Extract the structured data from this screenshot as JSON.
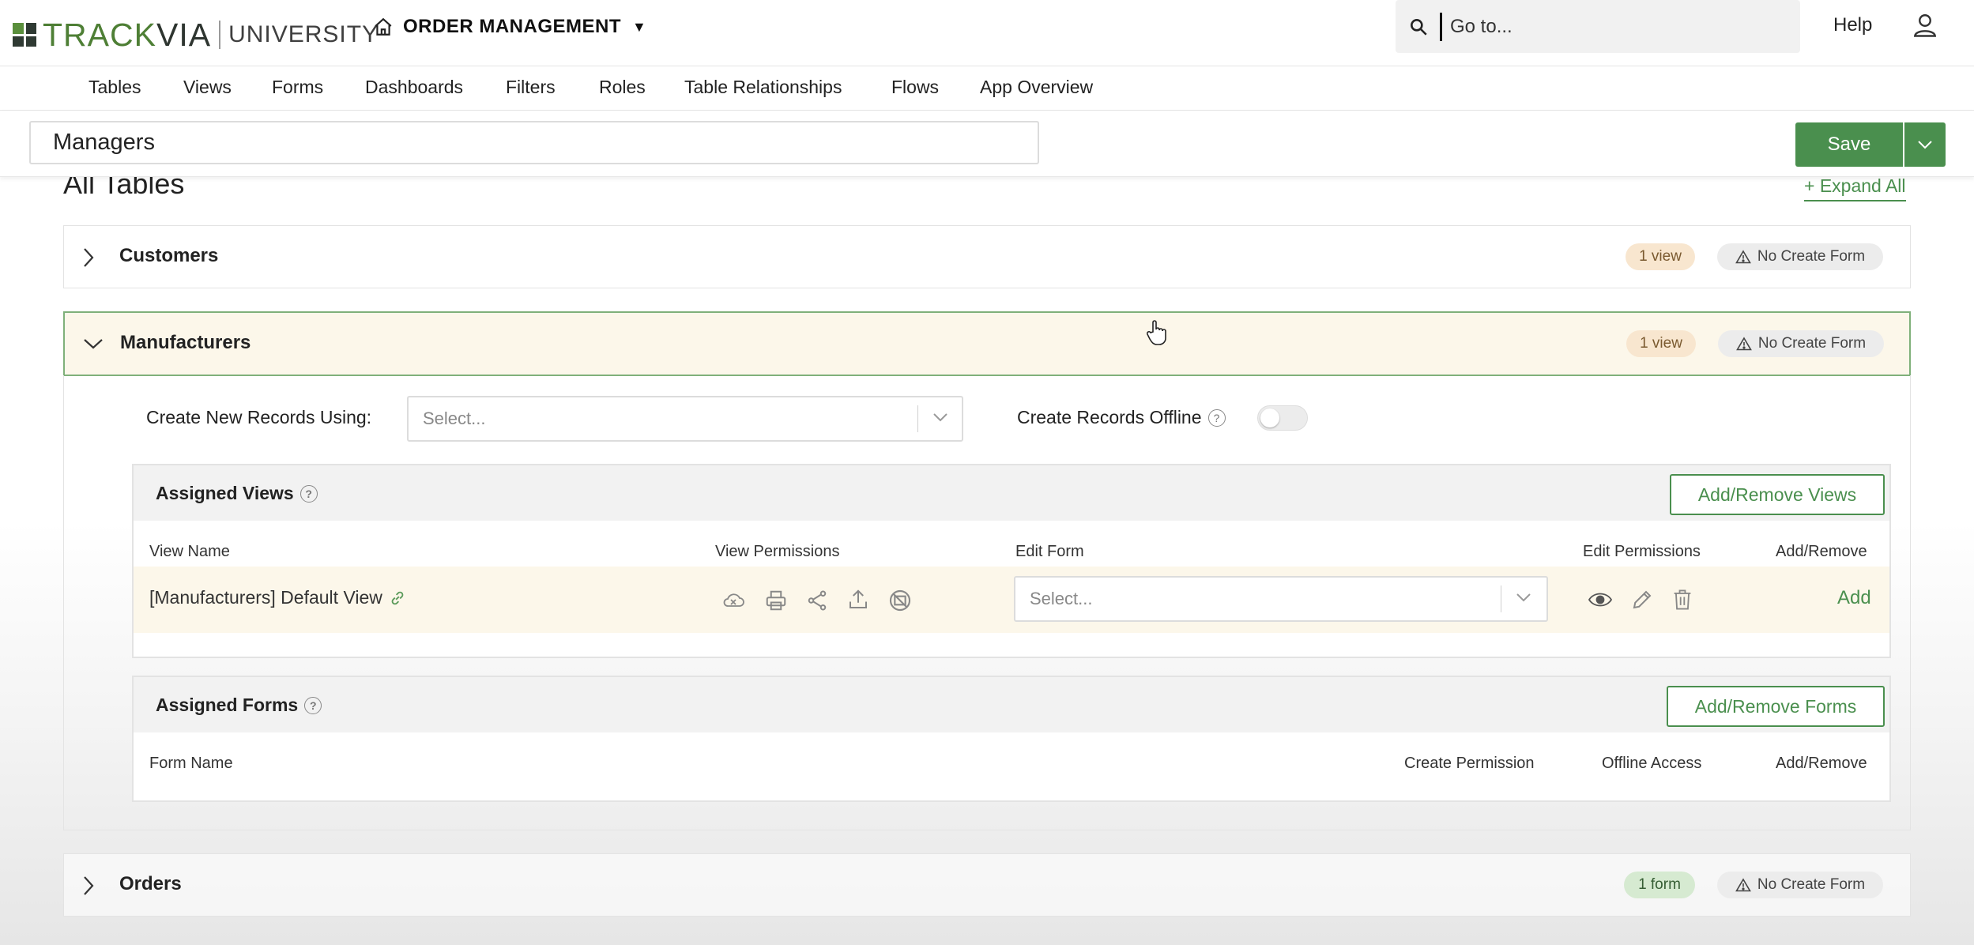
{
  "brand": {
    "track": "TRACK",
    "via": "VIA",
    "university": "UNIVERSITY",
    "accent": "#4a8f4e"
  },
  "app": {
    "title": "ORDER MANAGEMENT",
    "caret": "▼"
  },
  "search": {
    "placeholder": "Go to..."
  },
  "header": {
    "help": "Help"
  },
  "nav": [
    "Tables",
    "Views",
    "Forms",
    "Dashboards",
    "Filters",
    "Roles",
    "Table Relationships",
    "Flows",
    "App Overview"
  ],
  "role": {
    "name": "Managers",
    "save_label": "Save"
  },
  "section": {
    "title": "All Tables",
    "expand_all": "+ Expand All"
  },
  "tables": [
    {
      "name": "Customers",
      "badge": "1 view",
      "create_form": "No Create Form"
    },
    {
      "name": "Manufacturers",
      "badge": "1 view",
      "create_form": "No Create Form"
    },
    {
      "name": "Orders",
      "badge": "1 form",
      "create_form": "No Create Form"
    }
  ],
  "manufacturers": {
    "create_new_label": "Create New Records Using:",
    "create_new_placeholder": "Select...",
    "offline_label": "Create Records Offline",
    "offline_enabled": false,
    "assigned_views": {
      "title": "Assigned Views",
      "button": "Add/Remove Views",
      "columns": {
        "name": "View Name",
        "permissions": "View Permissions",
        "edit_form": "Edit Form",
        "edit_permissions": "Edit Permissions",
        "add_remove": "Add/Remove"
      },
      "rows": [
        {
          "name": "[Manufacturers] Default View",
          "edit_form_placeholder": "Select...",
          "add_label": "Add"
        }
      ]
    },
    "assigned_forms": {
      "title": "Assigned Forms",
      "button": "Add/Remove Forms",
      "columns": {
        "name": "Form Name",
        "create_permission": "Create Permission",
        "offline_access": "Offline Access",
        "add_remove": "Add/Remove"
      }
    }
  }
}
